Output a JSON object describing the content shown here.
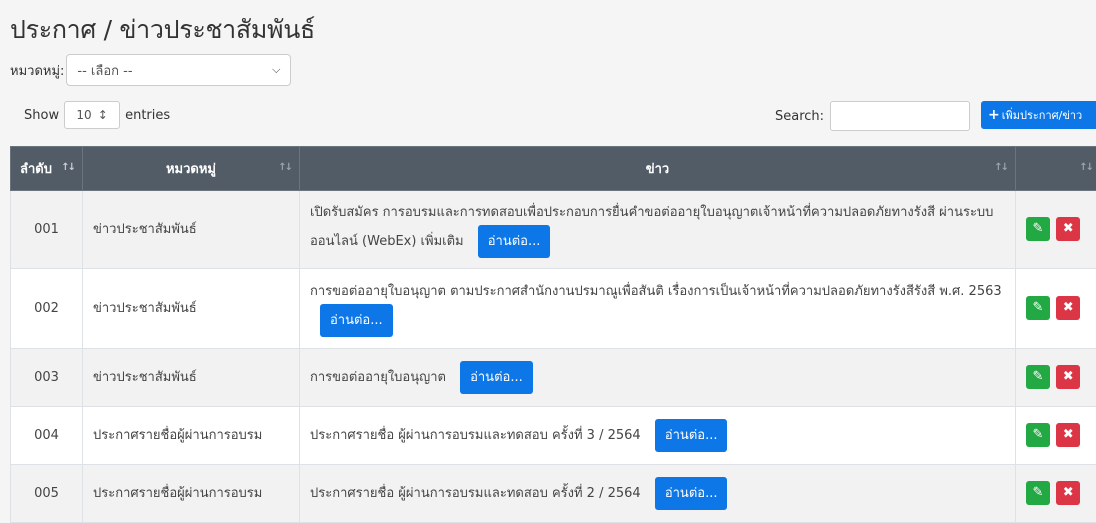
{
  "page": {
    "title": "ประกาศ / ข่าวประชาสัมพันธ์"
  },
  "filter": {
    "label": "หมวดหมู่:",
    "selected": "-- เลือก --"
  },
  "length": {
    "show": "Show",
    "value": "10",
    "entries": "entries"
  },
  "search": {
    "label": "Search:",
    "value": ""
  },
  "add_button": {
    "label": "เพิ่มประกาศ/ข่าว"
  },
  "table": {
    "headers": [
      "ลำดับ",
      "หมวดหมู่",
      "ข่าว",
      ""
    ],
    "rows": [
      {
        "no": "001",
        "category": "ข่าวประชาสัมพันธ์",
        "text": "เปิดรับสมัคร การอบรมและการทดสอบเพื่อประกอบการยื่นคำขอต่ออายุใบอนุญาตเจ้าหน้าที่ความปลอดภัยทางรังสี ผ่านระบบออนไลน์ (WebEx) เพิ่มเติม",
        "more": "อ่านต่อ..."
      },
      {
        "no": "002",
        "category": "ข่าวประชาสัมพันธ์",
        "text": "การขอต่ออายุใบอนุญาต ตามประกาศสำนักงานปรมาณูเพื่อสันติ เรื่องการเป็นเจ้าหน้าที่ความปลอดภัยทางรังสีรังสี พ.ศ. 2563",
        "more": "อ่านต่อ..."
      },
      {
        "no": "003",
        "category": "ข่าวประชาสัมพันธ์",
        "text": "การขอต่ออายุใบอนุญาต",
        "more": "อ่านต่อ..."
      },
      {
        "no": "004",
        "category": "ประกาศรายชื่อผู้ผ่านการอบรม",
        "text": "ประกาศรายชื่อ ผู้ผ่านการอบรมและทดสอบ ครั้งที่ 3 / 2564",
        "more": "อ่านต่อ..."
      },
      {
        "no": "005",
        "category": "ประกาศรายชื่อผู้ผ่านการอบรม",
        "text": "ประกาศรายชื่อ ผู้ผ่านการอบรมและทดสอบ ครั้งที่ 2 / 2564",
        "more": "อ่านต่อ..."
      }
    ]
  },
  "colors": {
    "primary": "#0d77e8",
    "success": "#23a944",
    "danger": "#dc3545",
    "header_bg": "#525c66"
  },
  "icons": {
    "sort": "sort-icon",
    "edit": "pencil-icon",
    "delete": "x-icon",
    "add": "plus-icon"
  }
}
